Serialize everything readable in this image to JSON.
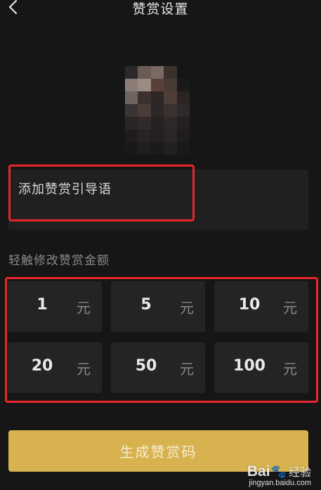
{
  "header": {
    "title": "赞赏设置",
    "back_icon": "chevron-left-icon"
  },
  "guide_input": {
    "placeholder": "添加赞赏引导语"
  },
  "amount_section": {
    "label": "轻触修改赞赏金额",
    "unit": "元",
    "amounts": [
      "1",
      "5",
      "10",
      "20",
      "50",
      "100"
    ]
  },
  "generate_button": {
    "label": "生成赞赏码"
  },
  "watermark": {
    "brand_part1": "Bai",
    "brand_part2": "经验",
    "url": "jingyan.baidu.com"
  },
  "colors": {
    "background": "#161616",
    "cell": "#242424",
    "button": "#d7b24f",
    "highlight": "#e8262b"
  }
}
